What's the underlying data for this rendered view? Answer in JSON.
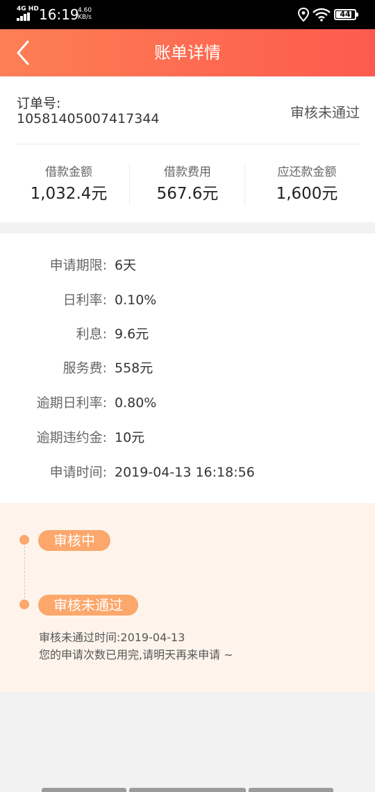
{
  "status_bar": {
    "network": "4G HD",
    "time": "16:19",
    "speed_value": "4.60",
    "speed_unit": "KB/s",
    "battery": "44"
  },
  "header": {
    "title": "账单详情"
  },
  "order": {
    "label": "订单号:",
    "number": "10581405007417344",
    "status": "审核未通过"
  },
  "summary": [
    {
      "label": "借款金额",
      "value": "1,032.4元"
    },
    {
      "label": "借款费用",
      "value": "567.6元"
    },
    {
      "label": "应还款金额",
      "value": "1,600元"
    }
  ],
  "details": [
    {
      "key": "申请期限:",
      "value": "6天"
    },
    {
      "key": "日利率:",
      "value": "0.10%"
    },
    {
      "key": "利息:",
      "value": "9.6元"
    },
    {
      "key": "服务费:",
      "value": "558元"
    },
    {
      "key": "逾期日利率:",
      "value": "0.80%"
    },
    {
      "key": "逾期违约金:",
      "value": "10元"
    },
    {
      "key": "申请时间:",
      "value": "2019-04-13 16:18:56"
    }
  ],
  "timeline": {
    "steps": [
      {
        "label": "审核中"
      },
      {
        "label": "审核未通过"
      }
    ],
    "reject_time": "审核未通过时间:2019-04-13",
    "message": "您的申请次数已用完,请明天再来申请 ~"
  },
  "colors": {
    "header_gradient_start": "#fd7f55",
    "header_gradient_end": "#fd5a4e",
    "timeline_accent": "#fca76b",
    "timeline_background": "#fff4ec"
  }
}
